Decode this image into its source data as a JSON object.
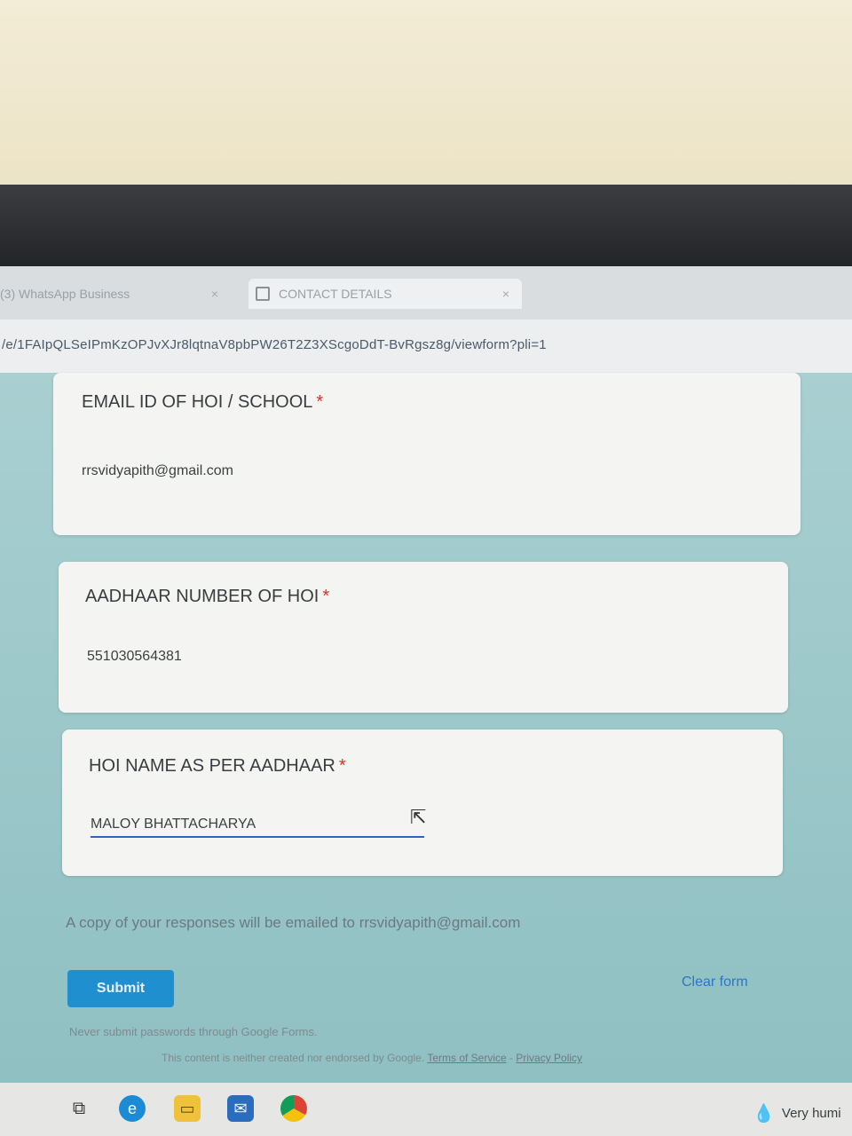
{
  "browser": {
    "tabs": [
      {
        "label": "(3) WhatsApp Business",
        "close": "×"
      },
      {
        "label": "CONTACT DETAILS",
        "close": "×"
      }
    ],
    "url": "/e/1FAIpQLSeIPmKzOPJvXJr8lqtnaV8pbPW26T2Z3XScgoDdT-BvRgsz8g/viewform?pli=1"
  },
  "form": {
    "questions": [
      {
        "title": "EMAIL ID OF HOI / SCHOOL",
        "required_mark": "*",
        "value": "rrsvidyapith@gmail.com"
      },
      {
        "title": "AADHAAR NUMBER OF HOI",
        "required_mark": "*",
        "value": "551030564381"
      },
      {
        "title": "HOI NAME AS PER AADHAAR",
        "required_mark": "*",
        "value": "MALOY BHATTACHARYA"
      }
    ],
    "copy_note": "A copy of your responses will be emailed to rrsvidyapith@gmail.com",
    "submit_label": "Submit",
    "clear_label": "Clear form",
    "never_note": "Never submit passwords through Google Forms.",
    "footer_text": "This content is neither created nor endorsed by Google.",
    "terms_label": "Terms of Service",
    "privacy_label": "Privacy Policy",
    "footer_sep": "-"
  },
  "taskbar": {
    "icons": [
      "task-view-icon",
      "edge-icon",
      "file-explorer-icon",
      "mail-icon",
      "chrome-icon"
    ],
    "weather_text": "Very humi"
  },
  "colors": {
    "accent": "#1f8fd0",
    "required": "#d93025",
    "link": "#2b77c2"
  }
}
